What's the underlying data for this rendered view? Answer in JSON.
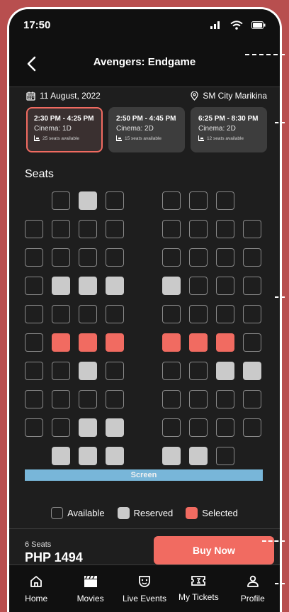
{
  "status": {
    "time": "17:50"
  },
  "header": {
    "title": "Avengers: Endgame"
  },
  "info": {
    "date": "11 August, 2022",
    "location": "SM City Marikina"
  },
  "showtimes": [
    {
      "time": "2:30 PM - 4:25 PM",
      "cinema": "Cinema: 1D",
      "seats": "25 seats available",
      "active": true
    },
    {
      "time": "2:50 PM - 4:45 PM",
      "cinema": "Cinema: 2D",
      "seats": "15 seats available",
      "active": false
    },
    {
      "time": "6:25 PM - 8:30 PM",
      "cinema": "Cinema: 2D",
      "seats": "12 seats available",
      "active": false
    }
  ],
  "seats_label": "Seats",
  "seat_map": [
    [
      "-",
      "A",
      "R",
      "A",
      "-",
      "A",
      "A",
      "A",
      "-"
    ],
    [
      "A",
      "A",
      "A",
      "A",
      "-",
      "A",
      "A",
      "A",
      "A"
    ],
    [
      "A",
      "A",
      "A",
      "A",
      "-",
      "A",
      "A",
      "A",
      "A"
    ],
    [
      "A",
      "R",
      "R",
      "R",
      "-",
      "R",
      "A",
      "A",
      "A"
    ],
    [
      "A",
      "A",
      "A",
      "A",
      "-",
      "A",
      "A",
      "A",
      "A"
    ],
    [
      "A",
      "S",
      "S",
      "S",
      "-",
      "S",
      "S",
      "S",
      "A"
    ],
    [
      "A",
      "A",
      "R",
      "A",
      "-",
      "A",
      "A",
      "R",
      "R"
    ],
    [
      "A",
      "A",
      "A",
      "A",
      "-",
      "A",
      "A",
      "A",
      "A"
    ],
    [
      "A",
      "A",
      "R",
      "R",
      "-",
      "A",
      "A",
      "A",
      "A"
    ],
    [
      "-",
      "R",
      "R",
      "R",
      "-",
      "R",
      "R",
      "A",
      "-"
    ]
  ],
  "screen_label": "Screen",
  "legend": {
    "available": "Available",
    "reserved": "Reserved",
    "selected": "Selected"
  },
  "checkout": {
    "seat_count": "6 Seats",
    "price": "PHP 1494",
    "buy_label": "Buy Now"
  },
  "tabs": [
    {
      "label": "Home",
      "icon": "home-icon"
    },
    {
      "label": "Movies",
      "icon": "clapperboard-icon"
    },
    {
      "label": "Live Events",
      "icon": "mask-icon"
    },
    {
      "label": "My Tickets",
      "icon": "ticket-icon"
    },
    {
      "label": "Profile",
      "icon": "user-icon"
    }
  ],
  "colors": {
    "accent": "#f16b61",
    "reserved": "#cacaca",
    "screen": "#78b6d9",
    "background": "#1e1e1e"
  }
}
